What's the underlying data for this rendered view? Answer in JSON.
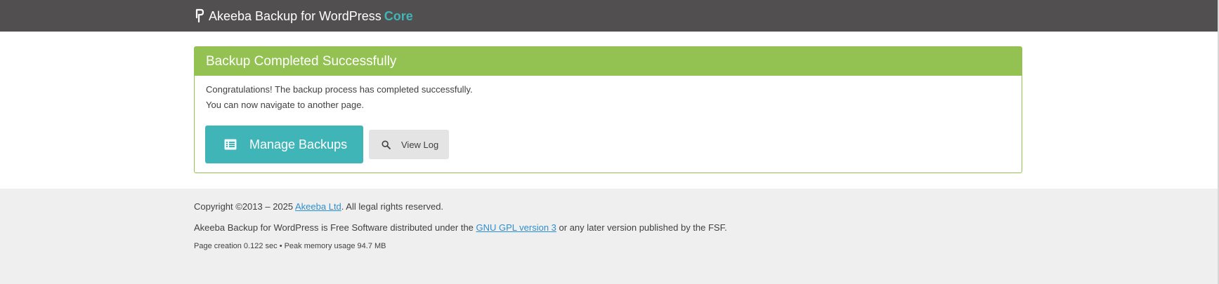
{
  "header": {
    "brand_text": "Akeeba Backup for WordPress",
    "edition": "Core",
    "icon": "akeeba-logo-icon"
  },
  "panel": {
    "title": "Backup Completed Successfully",
    "message_line1": "Congratulations! The backup process has completed successfully.",
    "message_line2": "You can now navigate to another page.",
    "manage_button": {
      "label": "Manage Backups",
      "icon": "list-icon"
    },
    "viewlog_button": {
      "label": "View Log",
      "icon": "search-icon"
    }
  },
  "footer": {
    "copyright_prefix": "Copyright ©2013 – 2025 ",
    "copyright_link": "Akeeba Ltd",
    "copyright_suffix": ". All legal rights reserved.",
    "license_prefix": "Akeeba Backup for WordPress is Free Software distributed under the ",
    "license_link": "GNU GPL version 3",
    "license_suffix": " or any later version published by the FSF.",
    "stats": "Page creation 0.122 sec • Peak memory usage 94.7 MB"
  },
  "colors": {
    "topbar": "#514f50",
    "accent_teal": "#40b5b8",
    "success_green": "#93c252",
    "footer_bg": "#efefef",
    "link": "#2e8fcf"
  }
}
